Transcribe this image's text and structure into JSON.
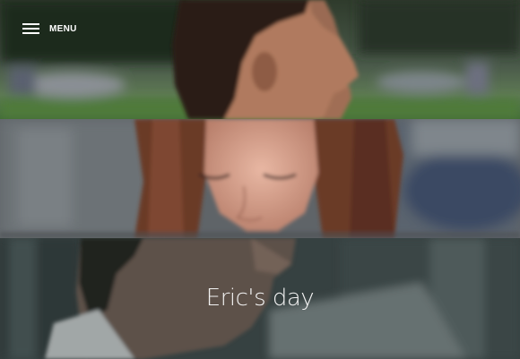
{
  "nav": {
    "menu_label": "MENU",
    "menu_icon": "hamburger-icon"
  },
  "hero": {
    "title": "Eric's day"
  },
  "panels": [
    {
      "subject": "man-in-profile-park"
    },
    {
      "subject": "woman-looking-down"
    },
    {
      "subject": "man-closeup-overlay"
    }
  ],
  "colors": {
    "text": "#ffffff",
    "overlay": "#3b4a4a"
  }
}
